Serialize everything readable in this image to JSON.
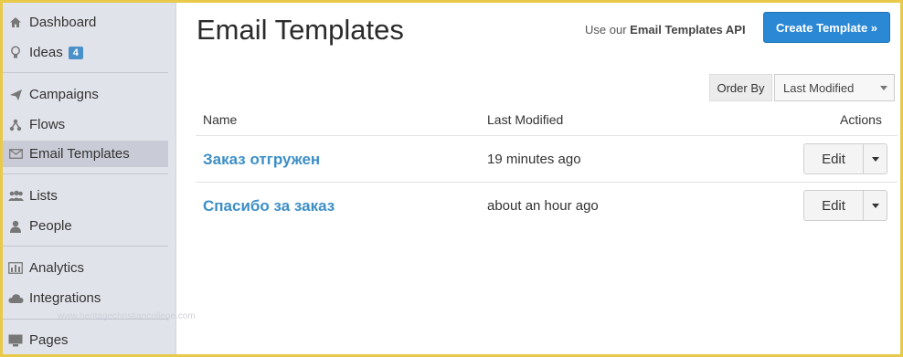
{
  "sidebar": {
    "items": [
      {
        "label": "Dashboard",
        "icon": "home-icon"
      },
      {
        "label": "Ideas",
        "icon": "lightbulb-icon",
        "badge": "4"
      },
      {
        "label": "Campaigns",
        "icon": "paper-plane-icon"
      },
      {
        "label": "Flows",
        "icon": "flow-icon"
      },
      {
        "label": "Email Templates",
        "icon": "envelope-icon",
        "active": true
      },
      {
        "label": "Lists",
        "icon": "users-icon"
      },
      {
        "label": "People",
        "icon": "user-icon"
      },
      {
        "label": "Analytics",
        "icon": "bar-chart-icon"
      },
      {
        "label": "Integrations",
        "icon": "cloud-icon"
      },
      {
        "label": "Pages",
        "icon": "monitor-icon"
      }
    ],
    "watermark": "www.heritagechristiancollege.com"
  },
  "header": {
    "title": "Email Templates",
    "api_hint_prefix": "Use our",
    "api_hint_link": "Email Templates API",
    "create_label": "Create Template »"
  },
  "sort": {
    "label": "Order By",
    "selected": "Last Modified"
  },
  "table": {
    "columns": [
      "Name",
      "Last Modified",
      "Actions"
    ],
    "rows": [
      {
        "name": "Заказ отгружен",
        "modified": "19 minutes ago",
        "action": "Edit"
      },
      {
        "name": "Спасибо за заказ",
        "modified": "about an hour ago",
        "action": "Edit"
      }
    ]
  },
  "colors": {
    "accent": "#2a88d4",
    "link": "#3d8fc6",
    "badge": "#4a90c9",
    "sidebar_bg": "#e1e3ea",
    "frame": "#e8c94a"
  }
}
